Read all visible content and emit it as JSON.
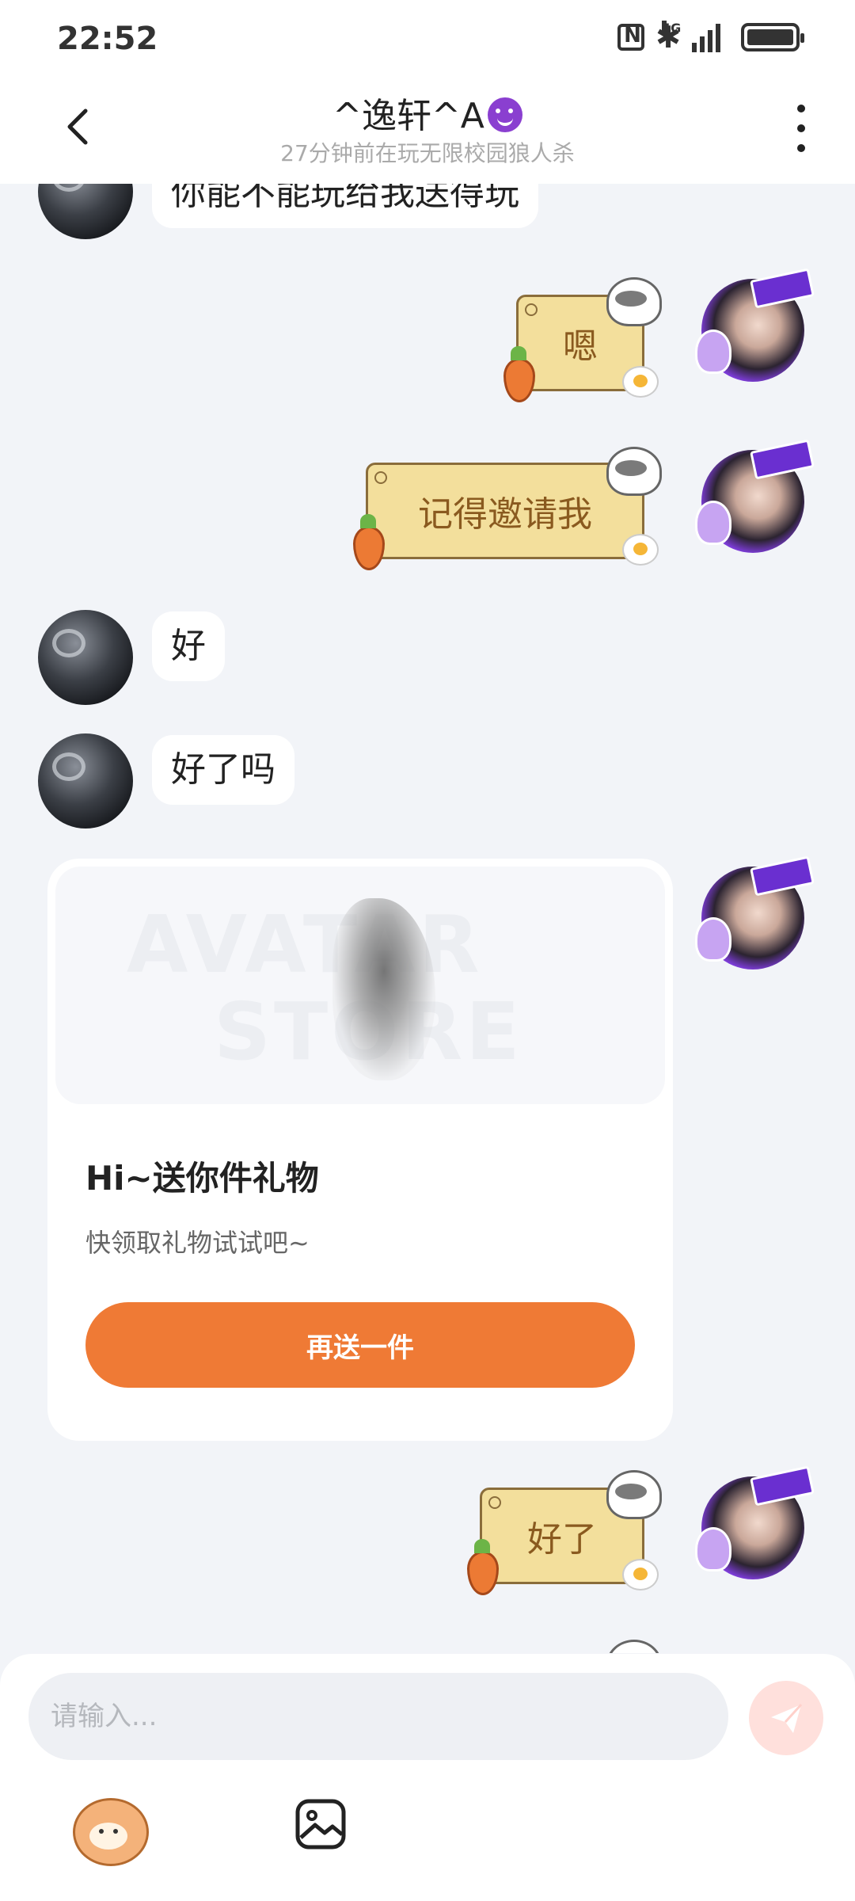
{
  "status_bar": {
    "time": "22:52",
    "network": "4G"
  },
  "header": {
    "title": "^逸轩^A",
    "subtitle": "27分钟前在玩无限校园狼人杀"
  },
  "messages": [
    {
      "from": "other",
      "text": "你能不能玩给我送得玩"
    },
    {
      "from": "me",
      "text": "嗯"
    },
    {
      "from": "me",
      "text": "记得邀请我"
    },
    {
      "from": "other",
      "text": "好"
    },
    {
      "from": "other",
      "text": "好了吗"
    },
    {
      "from": "me",
      "text": "好了"
    }
  ],
  "gift_card": {
    "watermark_1": "AVATAR",
    "watermark_2": "STORE",
    "title": "Hi~送你件礼物",
    "description": "快领取礼物试试吧~",
    "button": "再送一件"
  },
  "input": {
    "placeholder": "请输入..."
  },
  "icons": {
    "back": "back-arrow-icon",
    "more": "more-vertical-icon",
    "send": "send-paper-plane-icon",
    "emoji": "mascot-sticker-icon",
    "image": "image-picker-icon"
  },
  "colors": {
    "accent": "#ef7a35",
    "bubble_me": "#f3df9c",
    "bubble_me_text": "#8a5a1f",
    "background": "#f2f4f8"
  }
}
